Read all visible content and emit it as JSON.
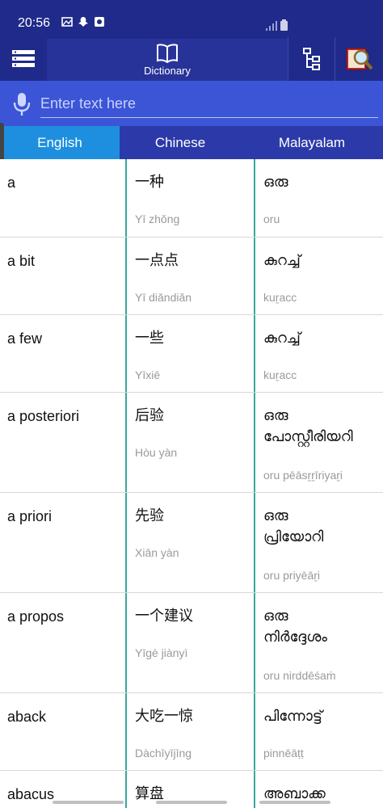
{
  "status": {
    "time": "20:56"
  },
  "toolbar": {
    "dictionary_label": "Dictionary"
  },
  "search": {
    "placeholder": "Enter text here"
  },
  "languages": [
    "English",
    "Chinese",
    "Malayalam"
  ],
  "rows": [
    {
      "english": "a",
      "chinese": "一种",
      "pinyin": "Yī zhǒng",
      "malayalam": "ഒരു",
      "malayalam_roman": "oru"
    },
    {
      "english": "a bit",
      "chinese": "一点点",
      "pinyin": "Yī diǎndiǎn",
      "malayalam": "കുറച്ച്",
      "malayalam_roman": "kuṟacc"
    },
    {
      "english": "a few",
      "chinese": "一些",
      "pinyin": "Yīxiē",
      "malayalam": "കുറച്ച്",
      "malayalam_roman": "kuṟacc"
    },
    {
      "english": "a posteriori",
      "chinese": "后验",
      "pinyin": "Hòu yàn",
      "malayalam": "ഒരു പോസ്റ്റീരിയറി",
      "malayalam_roman": "oru pēāsṟṟīriyaṟi"
    },
    {
      "english": "a priori",
      "chinese": "先验",
      "pinyin": "Xiān yàn",
      "malayalam": "ഒരു പ്രിയോറി",
      "malayalam_roman": "oru priyēāṟi"
    },
    {
      "english": "a propos",
      "chinese": "一个建议",
      "pinyin": "Yīgè jiànyì",
      "malayalam": "ഒരു നിർദ്ദേശം",
      "malayalam_roman": "oru nirddēśaṁ"
    },
    {
      "english": "aback",
      "chinese": "大吃一惊",
      "pinyin": "Dàchīyījīng",
      "malayalam": "പിന്നോട്ട്",
      "malayalam_roman": "pinnēāṭṭ"
    },
    {
      "english": "abacus",
      "chinese": "算盘",
      "pinyin": "",
      "malayalam": "അബാക്ക",
      "malayalam_roman": ""
    }
  ]
}
